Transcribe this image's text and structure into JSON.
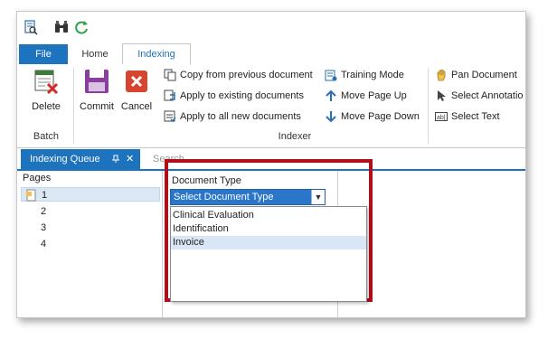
{
  "ribbon": {
    "tabs": [
      {
        "label": "File"
      },
      {
        "label": "Home"
      },
      {
        "label": "Indexing"
      }
    ],
    "batch_group": {
      "label": "Batch",
      "delete_label": "Delete"
    },
    "indexer_group": {
      "label": "Indexer",
      "commit_label": "Commit",
      "cancel_label": "Cancel",
      "copy_prev": "Copy from previous document",
      "apply_existing": "Apply to existing documents",
      "apply_all_new": "Apply to all new documents",
      "training_mode": "Training Mode",
      "move_up": "Move Page Up",
      "move_down": "Move Page Down",
      "pan_document": "Pan Document",
      "select_annotation": "Select Annotatio",
      "select_text": "Select Text"
    }
  },
  "dock": {
    "tabs": [
      {
        "label": "Indexing Queue"
      },
      {
        "label": "Search"
      }
    ],
    "pin_icon": "pin-icon",
    "close_icon": "close-icon"
  },
  "pages": {
    "header": "Pages",
    "items": [
      "1",
      "2",
      "3",
      "4"
    ]
  },
  "document_type": {
    "label": "Document Type",
    "selected": "Select Document Type",
    "options": [
      "Clinical Evaluation",
      "Identification",
      "Invoice"
    ]
  },
  "colors": {
    "accent": "#1e73be",
    "highlight_box": "#b00f1a"
  }
}
